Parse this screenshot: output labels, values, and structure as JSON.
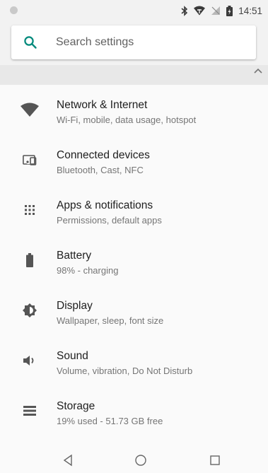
{
  "status_bar": {
    "time": "14:51",
    "icons": [
      "notification-dot-icon",
      "bluetooth-icon",
      "wifi-icon",
      "no-signal-icon",
      "battery-icon"
    ]
  },
  "search": {
    "placeholder": "Search settings",
    "icon": "search-icon",
    "accent_color": "#00897b"
  },
  "collapse": {
    "icon": "chevron-up-icon"
  },
  "settings": {
    "items": [
      {
        "title": "Network & Internet",
        "subtitle": "Wi-Fi, mobile, data usage, hotspot",
        "icon": "wifi-icon"
      },
      {
        "title": "Connected devices",
        "subtitle": "Bluetooth, Cast, NFC",
        "icon": "devices-icon"
      },
      {
        "title": "Apps & notifications",
        "subtitle": "Permissions, default apps",
        "icon": "apps-icon"
      },
      {
        "title": "Battery",
        "subtitle": "98% - charging",
        "icon": "battery-icon"
      },
      {
        "title": "Display",
        "subtitle": "Wallpaper, sleep, font size",
        "icon": "brightness-icon"
      },
      {
        "title": "Sound",
        "subtitle": "Volume, vibration, Do Not Disturb",
        "icon": "volume-icon"
      },
      {
        "title": "Storage",
        "subtitle": "19% used - 51.73 GB free",
        "icon": "storage-icon"
      }
    ]
  },
  "nav": {
    "buttons": [
      "back-icon",
      "home-icon",
      "recents-icon"
    ]
  }
}
